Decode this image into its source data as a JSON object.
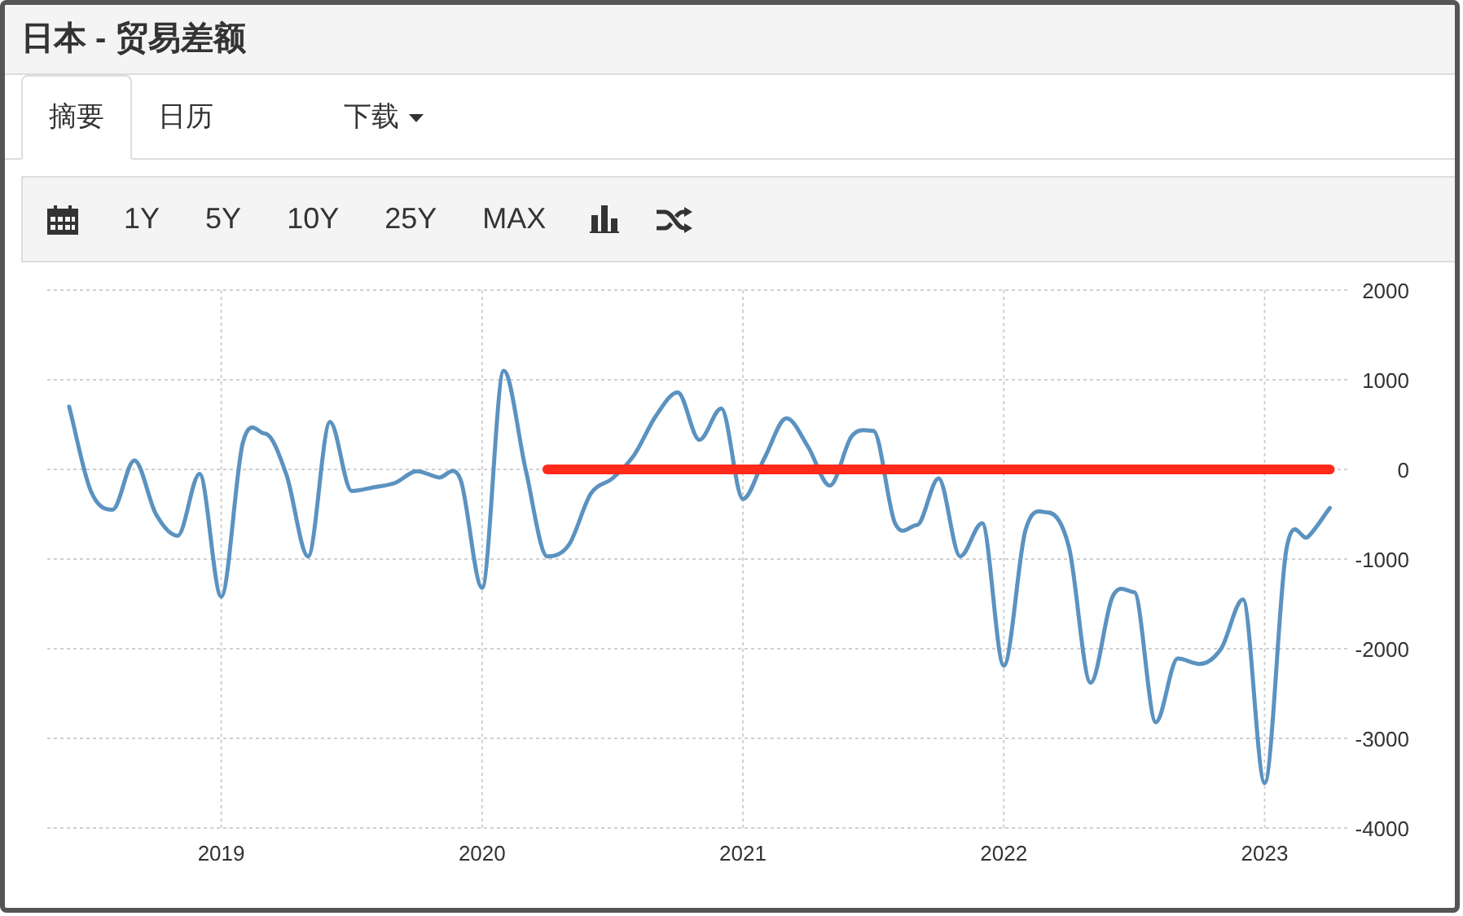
{
  "window": {
    "title": "日本 - 贸易差额"
  },
  "tabs": [
    {
      "label": "摘要",
      "selected": true,
      "kind": "tab"
    },
    {
      "label": "日历",
      "selected": false,
      "kind": "tab"
    },
    {
      "label": "下载",
      "selected": false,
      "kind": "dropdown"
    }
  ],
  "toolbar": {
    "ranges": [
      "1Y",
      "5Y",
      "10Y",
      "25Y",
      "MAX"
    ]
  },
  "chart": {
    "chart_data": {
      "type": "line",
      "x": [
        2018.417,
        2018.5,
        2018.583,
        2018.667,
        2018.75,
        2018.833,
        2018.917,
        2019,
        2019.083,
        2019.167,
        2019.25,
        2019.333,
        2019.417,
        2019.5,
        2019.583,
        2019.667,
        2019.75,
        2019.833,
        2019.917,
        2020,
        2020.083,
        2020.167,
        2020.25,
        2020.333,
        2020.417,
        2020.5,
        2020.583,
        2020.667,
        2020.75,
        2020.833,
        2020.917,
        2021,
        2021.083,
        2021.167,
        2021.25,
        2021.333,
        2021.417,
        2021.5,
        2021.583,
        2021.667,
        2021.75,
        2021.833,
        2021.917,
        2022,
        2022.083,
        2022.167,
        2022.25,
        2022.333,
        2022.417,
        2022.5,
        2022.583,
        2022.667,
        2022.75,
        2022.833,
        2022.917,
        2023,
        2023.083,
        2023.167,
        2023.25
      ],
      "series": [
        {
          "color": "#5b92c0",
          "values": [
            700,
            -240,
            -450,
            100,
            -500,
            -740,
            -50,
            -1420,
            300,
            400,
            -60,
            -970,
            530,
            -240,
            -200,
            -150,
            -20,
            -90,
            -110,
            -1320,
            1100,
            0,
            -970,
            -840,
            -270,
            -100,
            160,
            600,
            860,
            330,
            680,
            -330,
            130,
            570,
            250,
            -180,
            370,
            430,
            -600,
            -620,
            -100,
            -970,
            -600,
            -2190,
            -680,
            -480,
            -870,
            -2380,
            -1420,
            -1370,
            -2820,
            -2110,
            -2170,
            -2000,
            -1450,
            -3500,
            -900,
            -750,
            -430
          ]
        },
        {
          "color": "#ff2a1a",
          "values": [
            null,
            null,
            null,
            null,
            null,
            null,
            null,
            null,
            null,
            null,
            null,
            null,
            null,
            null,
            null,
            null,
            null,
            null,
            null,
            null,
            null,
            null,
            0,
            0,
            0,
            0,
            0,
            0,
            0,
            0,
            0,
            0,
            0,
            0,
            0,
            0,
            0,
            0,
            0,
            0,
            0,
            0,
            0,
            0,
            0,
            0,
            0,
            0,
            0,
            0,
            0,
            0,
            0,
            0,
            0,
            0,
            0,
            0,
            0
          ]
        }
      ],
      "grid": true,
      "xlim": [
        2018.333,
        2023.317
      ],
      "ylim": [
        -4000,
        2000
      ],
      "xticks": [
        2019,
        2020,
        2021,
        2022,
        2023
      ],
      "yticks": [
        2000,
        1000,
        0,
        -1000,
        -2000,
        -3000,
        -4000
      ]
    }
  }
}
